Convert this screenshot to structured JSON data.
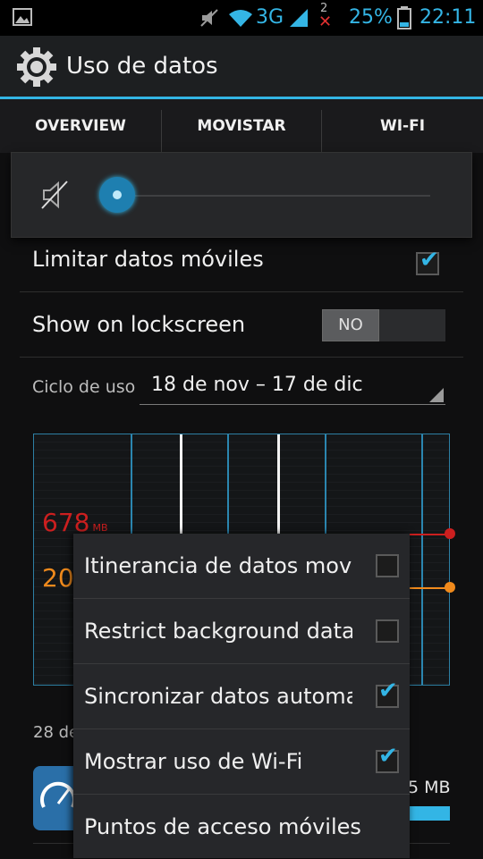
{
  "status_bar": {
    "network": "3G",
    "sim_indicator": "2",
    "battery_percent": "25%",
    "time": "22:11"
  },
  "action_bar": {
    "title": "Uso de datos"
  },
  "tabs": [
    {
      "label": "OVERVIEW"
    },
    {
      "label": "MOVISTAR"
    },
    {
      "label": "WI-FI"
    }
  ],
  "volume_overlay": {
    "level_fraction": 0.0
  },
  "settings": {
    "limit_mobile_data": {
      "label": "Limitar datos móviles",
      "checked": true
    },
    "show_on_lockscreen": {
      "label": "Show on lockscreen",
      "toggle": "NO"
    },
    "usage_cycle": {
      "label": "Ciclo de uso",
      "value": "18 de nov – 17 de dic"
    }
  },
  "chart": {
    "limit_value": "678",
    "limit_unit": "MB",
    "warning_value": "20",
    "limit_color": "#cc1f1f",
    "warning_color": "#f08a1c"
  },
  "footer": {
    "date_range_partial": "28 de",
    "app_usage_partial": "5 MB"
  },
  "overflow_menu": [
    {
      "label": "Itinerancia de datos mov",
      "has_checkbox": true,
      "checked": false
    },
    {
      "label": "Restrict background data",
      "has_checkbox": true,
      "checked": false
    },
    {
      "label": "Sincronizar datos automa",
      "has_checkbox": true,
      "checked": true
    },
    {
      "label": "Mostrar uso de Wi-Fi",
      "has_checkbox": true,
      "checked": true
    },
    {
      "label": "Puntos de acceso móviles",
      "has_checkbox": false,
      "checked": false
    }
  ],
  "colors": {
    "accent": "#33b5e5"
  }
}
